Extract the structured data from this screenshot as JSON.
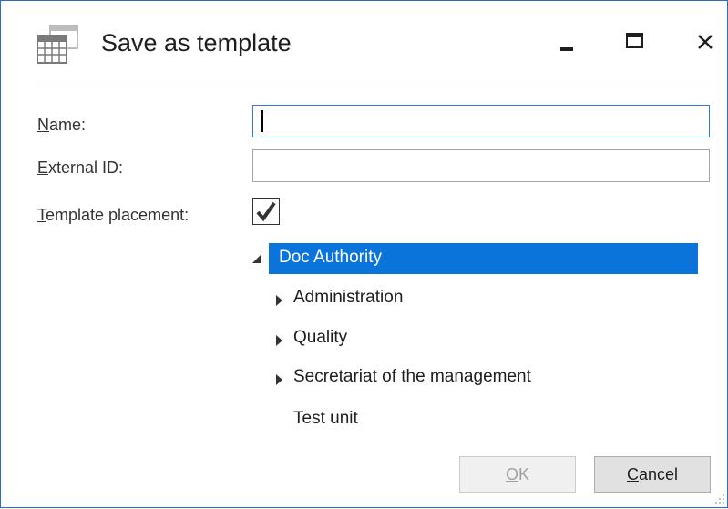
{
  "window": {
    "title": "Save as template",
    "icon": "calendar-grid-icon"
  },
  "form": {
    "name_label_accel": "N",
    "name_label_rest": "ame:",
    "name_value": "",
    "external_id_label_accel": "E",
    "external_id_label_rest": "xternal ID:",
    "external_id_value": "",
    "placement_label_accel": "T",
    "placement_label_rest": "emplate placement:",
    "placement_checked": true
  },
  "tree": {
    "root": {
      "label": "Doc Authority",
      "expanded": true,
      "selected": true
    },
    "children": [
      {
        "label": "Administration",
        "expandable": true
      },
      {
        "label": "Quality",
        "expandable": true
      },
      {
        "label": "Secretariat of the management",
        "expandable": true
      },
      {
        "label": "Test unit",
        "expandable": false
      }
    ]
  },
  "buttons": {
    "ok_accel": "O",
    "ok_rest": "K",
    "ok_enabled": false,
    "cancel_accel": "C",
    "cancel_rest": "ancel"
  },
  "colors": {
    "selection": "#0a74da",
    "window_border": "#2b6cc4",
    "focus_border": "#2f7bd3"
  }
}
